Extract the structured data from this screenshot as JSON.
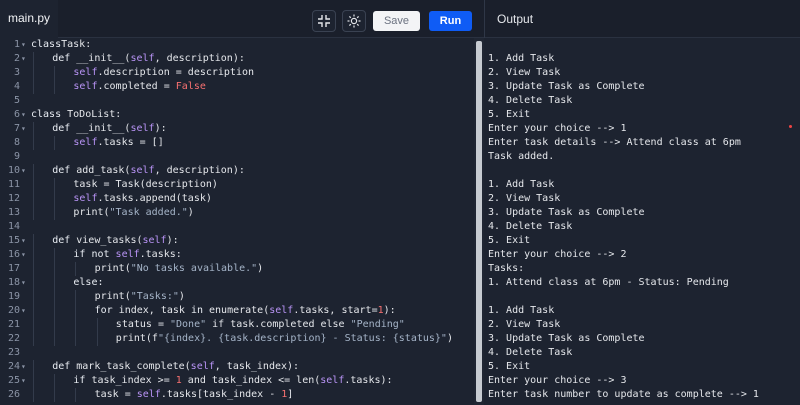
{
  "header": {
    "file_tab": "main.py",
    "save_label": "Save",
    "run_label": "Run",
    "output_title": "Output",
    "fullscreen_icon": "collapse-icon",
    "theme_icon": "brightness-icon"
  },
  "colors": {
    "run_button": "#0f5cf5",
    "keyword_self": "#b994f6",
    "literal_red": "#f87171",
    "background": "#1d2330"
  },
  "editor": {
    "lines": [
      {
        "n": "1",
        "fold": "▾",
        "indent": 0,
        "tokens": [
          [
            "kw",
            "class"
          ],
          [
            "",
            "Task:"
          ]
        ]
      },
      {
        "n": "2",
        "fold": "▾",
        "indent": 1,
        "tokens": [
          [
            "kw",
            "def"
          ],
          [
            "",
            " __init__("
          ],
          [
            "self",
            "self"
          ],
          [
            "",
            ", description):"
          ]
        ]
      },
      {
        "n": "3",
        "fold": "",
        "indent": 2,
        "tokens": [
          [
            "self",
            "self"
          ],
          [
            "",
            ".description = description"
          ]
        ]
      },
      {
        "n": "4",
        "fold": "",
        "indent": 2,
        "tokens": [
          [
            "self",
            "self"
          ],
          [
            "",
            ".completed = "
          ],
          [
            "bool",
            "False"
          ]
        ]
      },
      {
        "n": "5",
        "fold": "",
        "indent": 0,
        "tokens": []
      },
      {
        "n": "6",
        "fold": "▾",
        "indent": 0,
        "tokens": [
          [
            "kw",
            "class"
          ],
          [
            "",
            " ToDoList:"
          ]
        ]
      },
      {
        "n": "7",
        "fold": "▾",
        "indent": 1,
        "tokens": [
          [
            "kw",
            "def"
          ],
          [
            "",
            " __init__("
          ],
          [
            "self",
            "self"
          ],
          [
            "",
            "):"
          ]
        ]
      },
      {
        "n": "8",
        "fold": "",
        "indent": 2,
        "tokens": [
          [
            "self",
            "self"
          ],
          [
            "",
            ".tasks = []"
          ]
        ]
      },
      {
        "n": "9",
        "fold": "",
        "indent": 0,
        "tokens": []
      },
      {
        "n": "10",
        "fold": "▾",
        "indent": 1,
        "tokens": [
          [
            "kw",
            "def"
          ],
          [
            "",
            " add_task("
          ],
          [
            "self",
            "self"
          ],
          [
            "",
            ", description):"
          ]
        ]
      },
      {
        "n": "11",
        "fold": "",
        "indent": 2,
        "tokens": [
          [
            "",
            "task = Task(description)"
          ]
        ]
      },
      {
        "n": "12",
        "fold": "",
        "indent": 2,
        "tokens": [
          [
            "self",
            "self"
          ],
          [
            "",
            ".tasks.append(task)"
          ]
        ]
      },
      {
        "n": "13",
        "fold": "",
        "indent": 2,
        "tokens": [
          [
            "",
            "print("
          ],
          [
            "str",
            "\"Task added.\""
          ],
          [
            "",
            ")"
          ]
        ]
      },
      {
        "n": "14",
        "fold": "",
        "indent": 0,
        "tokens": []
      },
      {
        "n": "15",
        "fold": "▾",
        "indent": 1,
        "tokens": [
          [
            "kw",
            "def"
          ],
          [
            "",
            " view_tasks("
          ],
          [
            "self",
            "self"
          ],
          [
            "",
            "):"
          ]
        ]
      },
      {
        "n": "16",
        "fold": "▾",
        "indent": 2,
        "tokens": [
          [
            "kw",
            "if not "
          ],
          [
            "self",
            "self"
          ],
          [
            "",
            ".tasks:"
          ]
        ]
      },
      {
        "n": "17",
        "fold": "",
        "indent": 3,
        "tokens": [
          [
            "",
            "print("
          ],
          [
            "str",
            "\"No tasks available.\""
          ],
          [
            "",
            ")"
          ]
        ]
      },
      {
        "n": "18",
        "fold": "▾",
        "indent": 2,
        "tokens": [
          [
            "kw",
            "else:"
          ]
        ]
      },
      {
        "n": "19",
        "fold": "",
        "indent": 3,
        "tokens": [
          [
            "",
            "print("
          ],
          [
            "str",
            "\"Tasks:\""
          ],
          [
            "",
            ")"
          ]
        ]
      },
      {
        "n": "20",
        "fold": "▾",
        "indent": 3,
        "tokens": [
          [
            "kw",
            "for"
          ],
          [
            "",
            " index, task "
          ],
          [
            "kw",
            "in"
          ],
          [
            "",
            " enumerate("
          ],
          [
            "self",
            "self"
          ],
          [
            "",
            ".tasks, start="
          ],
          [
            "num",
            "1"
          ],
          [
            "",
            "):"
          ]
        ]
      },
      {
        "n": "21",
        "fold": "",
        "indent": 4,
        "tokens": [
          [
            "",
            "status = "
          ],
          [
            "str",
            "\"Done\""
          ],
          [
            "",
            " if task.completed else "
          ],
          [
            "str",
            "\"Pending\""
          ]
        ]
      },
      {
        "n": "22",
        "fold": "",
        "indent": 4,
        "tokens": [
          [
            "",
            "print(f"
          ],
          [
            "str",
            "\"{index}. {task.description} - Status: {status}\""
          ],
          [
            "",
            ")"
          ]
        ]
      },
      {
        "n": "23",
        "fold": "",
        "indent": 0,
        "tokens": []
      },
      {
        "n": "24",
        "fold": "▾",
        "indent": 1,
        "tokens": [
          [
            "kw",
            "def"
          ],
          [
            "",
            " mark_task_complete("
          ],
          [
            "self",
            "self"
          ],
          [
            "",
            ", task_index):"
          ]
        ]
      },
      {
        "n": "25",
        "fold": "▾",
        "indent": 2,
        "tokens": [
          [
            "kw",
            "if"
          ],
          [
            "",
            " task_index >= "
          ],
          [
            "num",
            "1"
          ],
          [
            "",
            " and task_index <= len("
          ],
          [
            "self",
            "self"
          ],
          [
            "",
            ".tasks):"
          ]
        ]
      },
      {
        "n": "26",
        "fold": "",
        "indent": 3,
        "tokens": [
          [
            "",
            "task = "
          ],
          [
            "self",
            "self"
          ],
          [
            "",
            ".tasks[task_index - "
          ],
          [
            "num",
            "1"
          ],
          [
            "",
            "]"
          ]
        ]
      }
    ]
  },
  "output": {
    "lines": [
      "1. Add Task",
      "2. View Task",
      "3. Update Task as Complete",
      "4. Delete Task",
      "5. Exit",
      "Enter your choice --> 1",
      "Enter task details --> Attend class at 6pm",
      "Task added.",
      "",
      "1. Add Task",
      "2. View Task",
      "3. Update Task as Complete",
      "4. Delete Task",
      "5. Exit",
      "Enter your choice --> 2",
      "Tasks:",
      "1. Attend class at 6pm - Status: Pending",
      "",
      "1. Add Task",
      "2. View Task",
      "3. Update Task as Complete",
      "4. Delete Task",
      "5. Exit",
      "Enter your choice --> 3",
      "Enter task number to update as complete --> 1"
    ]
  }
}
